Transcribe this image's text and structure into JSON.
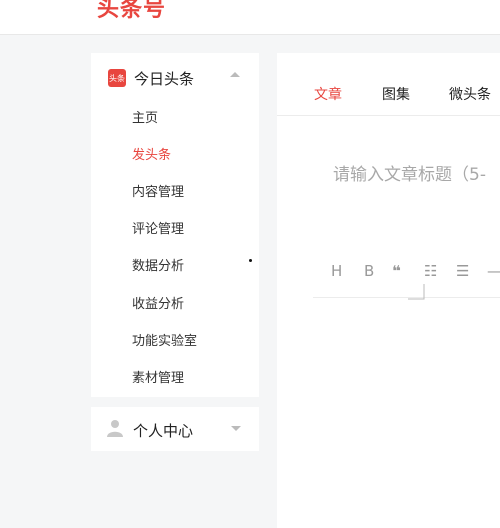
{
  "header": {
    "logo_text": "头条号"
  },
  "sidebar": {
    "section": {
      "badge": "头条",
      "title": "今日头条"
    },
    "items": [
      {
        "label": "主页",
        "active": false
      },
      {
        "label": "发头条",
        "active": true
      },
      {
        "label": "内容管理",
        "active": false
      },
      {
        "label": "评论管理",
        "active": false
      },
      {
        "label": "数据分析",
        "active": false
      },
      {
        "label": "收益分析",
        "active": false
      },
      {
        "label": "功能实验室",
        "active": false
      },
      {
        "label": "素材管理",
        "active": false
      }
    ]
  },
  "personal": {
    "title": "个人中心"
  },
  "main": {
    "tabs": [
      {
        "label": "文章"
      },
      {
        "label": "图集"
      },
      {
        "label": "微头条"
      }
    ],
    "title_placeholder": "请输入文章标题（5-",
    "toolbar": {
      "heading": "H",
      "bold": "B",
      "quote": "❝",
      "unordered_list": "☷",
      "ordered_list": "☰",
      "divider": "—"
    }
  },
  "colors": {
    "accent": "#e8463f",
    "text": "#222222",
    "muted": "#999999"
  }
}
